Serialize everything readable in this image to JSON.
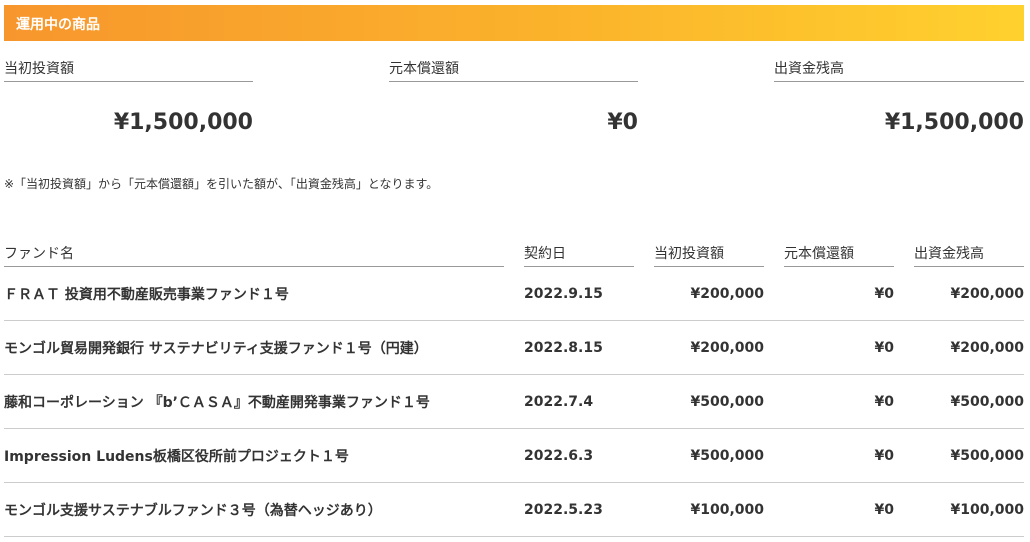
{
  "section_title": "運用中の商品",
  "summary": [
    {
      "label": "当初投資額",
      "value": "¥1,500,000"
    },
    {
      "label": "元本償還額",
      "value": "¥0"
    },
    {
      "label": "出資金残高",
      "value": "¥1,500,000"
    }
  ],
  "note": "※「当初投資額」から「元本償還額」を引いた額が、「出資金残高」となります。",
  "table": {
    "headers": [
      "ファンド名",
      "契約日",
      "当初投資額",
      "元本償還額",
      "出資金残高"
    ],
    "rows": [
      [
        "ＦＲＡＴ 投資用不動産販売事業ファンド１号",
        "2022.9.15",
        "¥200,000",
        "¥0",
        "¥200,000"
      ],
      [
        "モンゴル貿易開発銀行 サステナビリティ支援ファンド１号（円建）",
        "2022.8.15",
        "¥200,000",
        "¥0",
        "¥200,000"
      ],
      [
        "藤和コーポレーション 『b’ＣＡＳＡ』不動産開発事業ファンド１号",
        "2022.7.4",
        "¥500,000",
        "¥0",
        "¥500,000"
      ],
      [
        "Impression Ludens板橋区役所前プロジェクト１号",
        "2022.6.3",
        "¥500,000",
        "¥0",
        "¥500,000"
      ],
      [
        "モンゴル支援サステナブルファンド３号（為替ヘッジあり）",
        "2022.5.23",
        "¥100,000",
        "¥0",
        "¥100,000"
      ]
    ]
  }
}
